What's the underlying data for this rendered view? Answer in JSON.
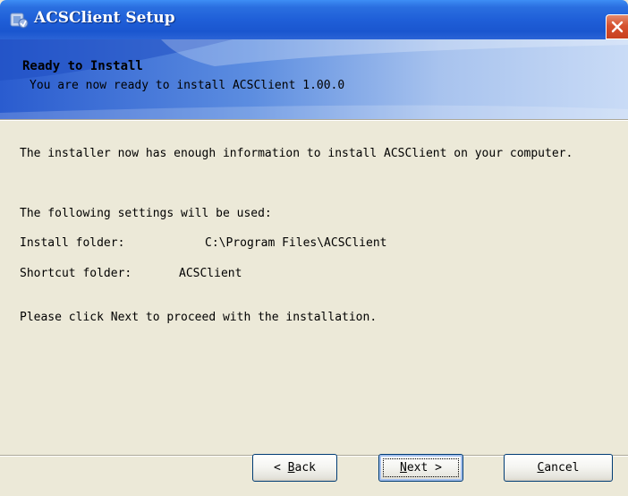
{
  "window": {
    "title": "ACSClient Setup",
    "app_icon": "installer-icon",
    "close_icon": "close-icon"
  },
  "banner": {
    "heading": "Ready to Install",
    "subheading": "You are now ready to install ACSClient 1.00.0"
  },
  "content": {
    "intro": "The installer now has enough information to install ACSClient on your computer.",
    "following": "The following settings will be used:",
    "install_folder_label": "Install folder:",
    "install_folder_value": "C:\\Program Files\\ACSClient",
    "shortcut_folder_label": "Shortcut folder:",
    "shortcut_folder_value": "ACSClient",
    "proceed": "Please click Next to proceed with the installation."
  },
  "buttons": {
    "back": {
      "arrow": "<",
      "mnemonic": "B",
      "rest": "ack"
    },
    "next": {
      "mnemonic": "N",
      "rest": "ext",
      "arrow": ">"
    },
    "cancel": {
      "mnemonic": "C",
      "rest": "ancel"
    }
  },
  "colors": {
    "titlebar": "#1f5fd8",
    "close_button": "#d6512f",
    "dialog_background": "#ece9d8"
  }
}
